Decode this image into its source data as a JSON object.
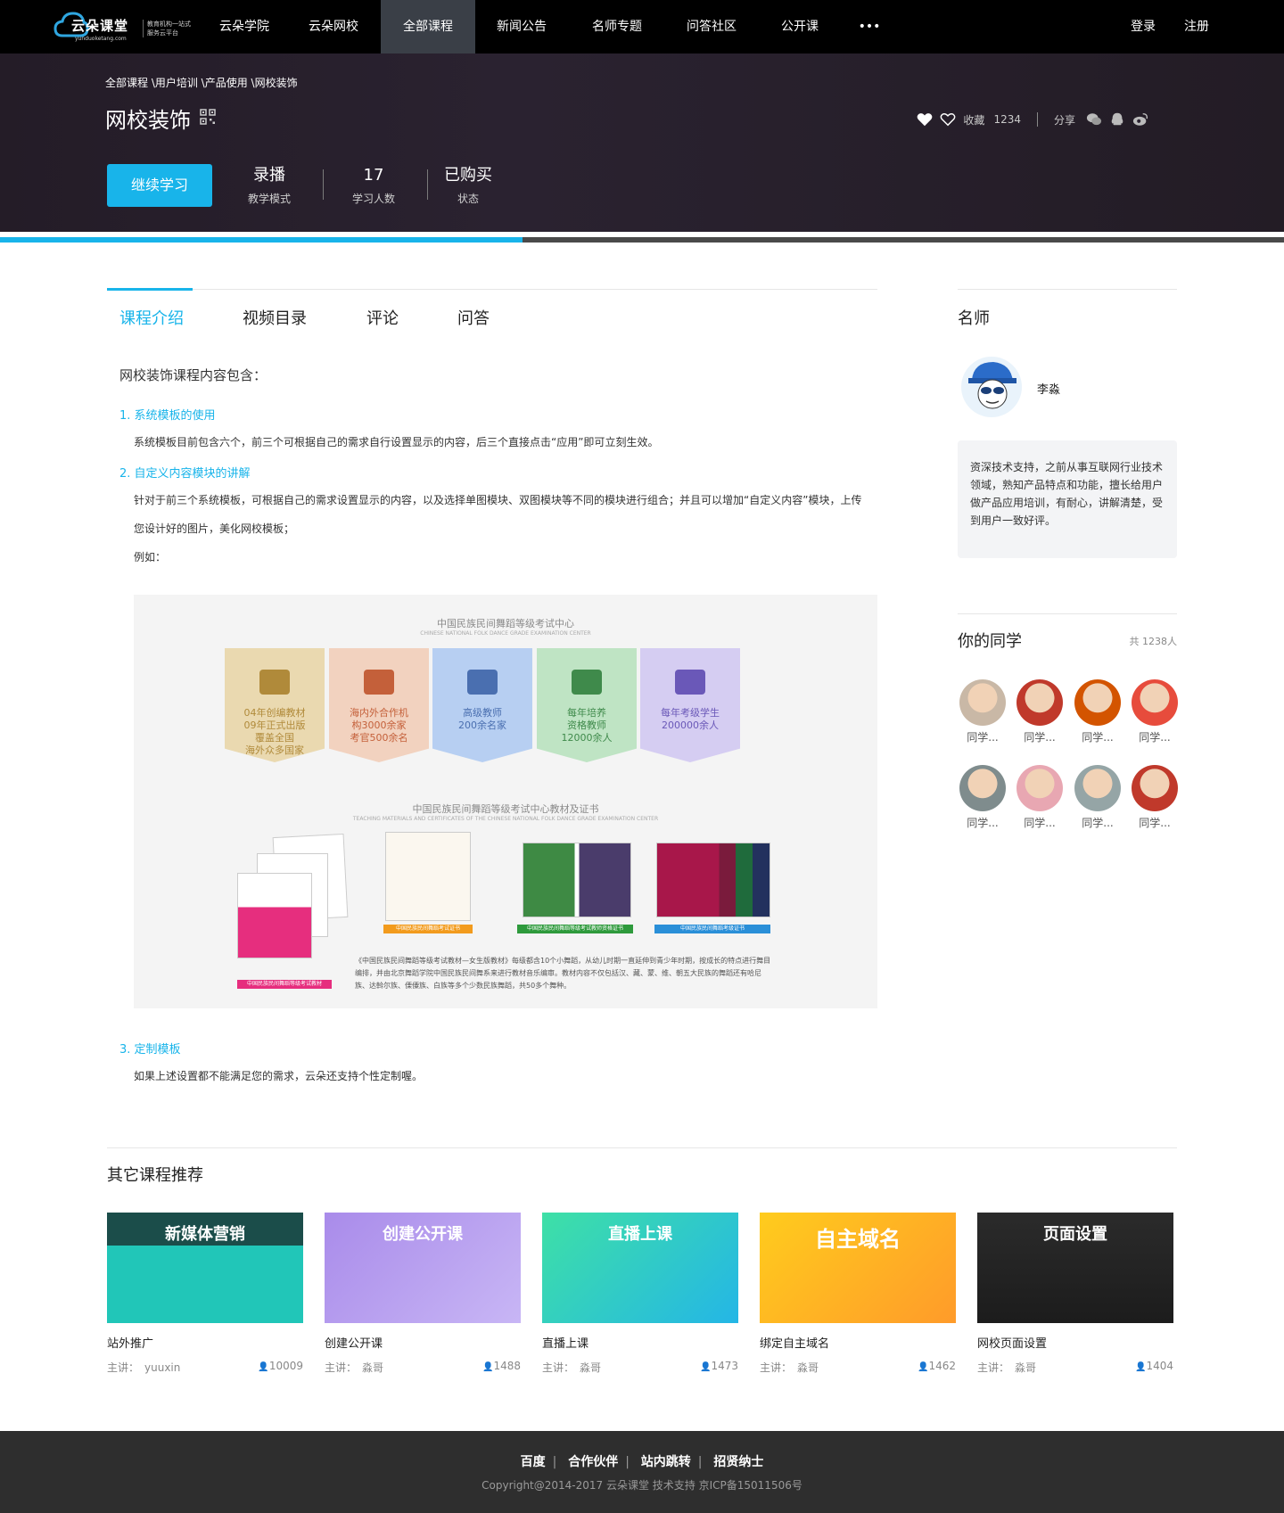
{
  "nav": {
    "logo_text": "云朵课堂",
    "logo_url": "yunduoketang.com",
    "logo_tagline": "教育机构一站式服务云平台",
    "items": [
      "云朵学院",
      "云朵网校",
      "全部课程",
      "新闻公告",
      "名师专题",
      "问答社区",
      "公开课",
      "•••"
    ],
    "active_index": 2,
    "login": "登录",
    "register": "注册"
  },
  "hero": {
    "breadcrumb": "全部课程 \\用户培训 \\产品使用 \\网校装饰",
    "title": "网校装饰",
    "favorite_label": "收藏",
    "favorite_count": "1234",
    "share_label": "分享",
    "cta": "继续学习",
    "stats": [
      {
        "value": "录播",
        "label": "教学模式"
      },
      {
        "value": "17",
        "label": "学习人数"
      },
      {
        "value": "已购买",
        "label": "状态"
      }
    ],
    "progress_fraction": 0.407
  },
  "tabs": [
    "课程介绍",
    "视频目录",
    "评论",
    "问答"
  ],
  "content": {
    "intro": "网校装饰课程内容包含：",
    "sections": [
      {
        "heading": "1. 系统模板的使用",
        "paragraphs": [
          "系统模板目前包含六个，前三个可根据自己的需求自行设置显示的内容，后三个直接点击“应用”即可立刻生效。"
        ]
      },
      {
        "heading": "2. 自定义内容模块的讲解",
        "paragraphs": [
          "针对于前三个系统模板，可根据自己的需求设置显示的内容，以及选择单图模块、双图模块等不同的模块进行组合；并且可以增加“自定义内容”模块，上传",
          "您设计好的图片，美化网校模板；",
          "例如："
        ]
      },
      {
        "heading": "3. 定制模板",
        "paragraphs": [
          "如果上述设置都不能满足您的需求，云朵还支持个性定制喔。"
        ]
      }
    ],
    "figure": {
      "title1": "中国民族民间舞蹈等级考试中心",
      "sub1": "CHINESE NATIONAL FOLK DANCE GRADE EXAMINATION CENTER",
      "ribbons": [
        {
          "text": "04年创编教材\n09年正式出版\n覆盖全国\n海外众多国家",
          "bg": "#ead9b0",
          "fg": "#b08a3a"
        },
        {
          "text": "海内外合作机\n构3000余家\n考官500余名",
          "bg": "#f2d2bf",
          "fg": "#c4603a"
        },
        {
          "text": "高级教师\n200余名家",
          "bg": "#b7cff2",
          "fg": "#4a6fb0"
        },
        {
          "text": "每年培养\n资格教师\n12000余人",
          "bg": "#bfe4c4",
          "fg": "#3f8a4b"
        },
        {
          "text": "每年考级学生\n200000余人",
          "bg": "#d5cdf2",
          "fg": "#6a58b8"
        }
      ],
      "title2": "中国民族民间舞蹈等级考试中心教材及证书",
      "sub2": "TEACHING MATERIALS AND CERTIFICATES OF THE CHINESE NATIONAL FOLK DANCE GRADE EXAMINATION CENTER",
      "cert_captions": [
        "中国民族民间舞蹈等级考试教材",
        "中国民族民间舞蹈考试证书",
        "中国民族民间舞蹈等级考试教师资格证书",
        "中国民族民间舞蹈考级证书"
      ],
      "note": "《中国民族民间舞蹈等级考试教材—女生版教材》每级都含10个小舞蹈，从幼儿时期一直延伸到青少年时期，按成长的特点进行舞目编排，并由北京舞蹈学院中国民族民间舞系来进行教材音乐编审。教材内容不仅包括汉、藏、蒙、维、朝五大民族的舞蹈还有哈尼族、达斡尔族、傈僳族、白族等多个少数民族舞蹈，共50多个舞种。"
    }
  },
  "sidebar": {
    "teacher_title": "名师",
    "teacher_name": "李淼",
    "teacher_bio": "资深技术支持，之前从事互联网行业技术领域，熟知产品特点和功能，擅长给用户做产品应用培训，有耐心，讲解清楚，受到用户一致好评。",
    "classmates_title": "你的同学",
    "classmates_count": "共 1238人",
    "classmates": [
      "同学...",
      "同学...",
      "同学...",
      "同学...",
      "同学...",
      "同学...",
      "同学...",
      "同学..."
    ]
  },
  "recommend": {
    "title": "其它课程推荐",
    "lecturer_prefix": "主讲：",
    "courses": [
      {
        "name": "站外推广",
        "lecturer": "yuuxin",
        "count": "10009",
        "thumb_text": "新媒体营销"
      },
      {
        "name": "创建公开课",
        "lecturer": "淼哥",
        "count": "1488",
        "thumb_text": "创建公开课"
      },
      {
        "name": "直播上课",
        "lecturer": "淼哥",
        "count": "1473",
        "thumb_text": "直播上课"
      },
      {
        "name": "绑定自主域名",
        "lecturer": "淼哥",
        "count": "1462",
        "thumb_text": "自主域名"
      },
      {
        "name": "网校页面设置",
        "lecturer": "淼哥",
        "count": "1404",
        "thumb_text": "页面设置"
      }
    ]
  },
  "footer": {
    "links": [
      "百度",
      "合作伙伴",
      "站内跳转",
      "招贤纳士"
    ],
    "copyright": "Copyright@2014-2017 云朵课堂    技术支持    京ICP备15011506号"
  },
  "colors": {
    "accent": "#18b4ea",
    "nav_bg": "#000000",
    "footer_bg": "#2e2e2e"
  }
}
